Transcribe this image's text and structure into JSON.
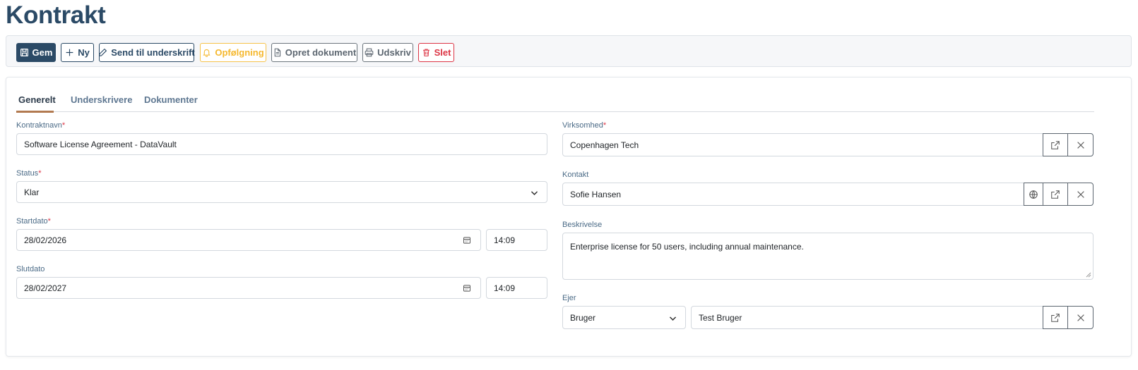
{
  "page": {
    "title": "Kontrakt"
  },
  "toolbar": {
    "save_label": "Gem",
    "new_label": "Ny",
    "send_label": "Send til underskrift",
    "followup_label": "Opfølgning",
    "create_doc_label": "Opret dokument",
    "print_label": "Udskriv",
    "delete_label": "Slet"
  },
  "tabs": [
    {
      "label": "Generelt",
      "active": true
    },
    {
      "label": "Underskrivere",
      "active": false
    },
    {
      "label": "Dokumenter",
      "active": false
    }
  ],
  "form": {
    "contract_name": {
      "label": "Kontraktnavn",
      "required": "*",
      "value": "Software License Agreement - DataVault"
    },
    "status": {
      "label": "Status",
      "required": "*",
      "value": "Klar"
    },
    "start_date": {
      "label": "Startdato",
      "required": "*",
      "date": "28/02/2026",
      "time": "14:09"
    },
    "end_date": {
      "label": "Slutdato",
      "date": "28/02/2027",
      "time": "14:09"
    },
    "company": {
      "label": "Virksomhed",
      "required": "*",
      "value": "Copenhagen Tech"
    },
    "contact": {
      "label": "Kontakt",
      "value": "Sofie Hansen"
    },
    "description": {
      "label": "Beskrivelse",
      "value": "Enterprise license for 50 users, including annual maintenance."
    },
    "owner": {
      "label": "Ejer",
      "type_value": "Bruger",
      "value": "Test Bruger"
    }
  },
  "colors": {
    "primary": "#2b4a66",
    "warning": "#f5b82e",
    "danger": "#dc3545",
    "secondary": "#6c757d",
    "tab_accent": "#b27a50"
  },
  "icons": {
    "save": "floppy-disk-icon",
    "new": "plus-icon",
    "send": "pencil-icon",
    "followup": "bell-icon",
    "create_doc": "document-icon",
    "print": "printer-icon",
    "delete": "trash-icon",
    "calendar": "calendar-icon",
    "open": "external-link-icon",
    "clear": "close-icon",
    "globe": "globe-icon",
    "dropdown": "chevron-down-icon"
  }
}
